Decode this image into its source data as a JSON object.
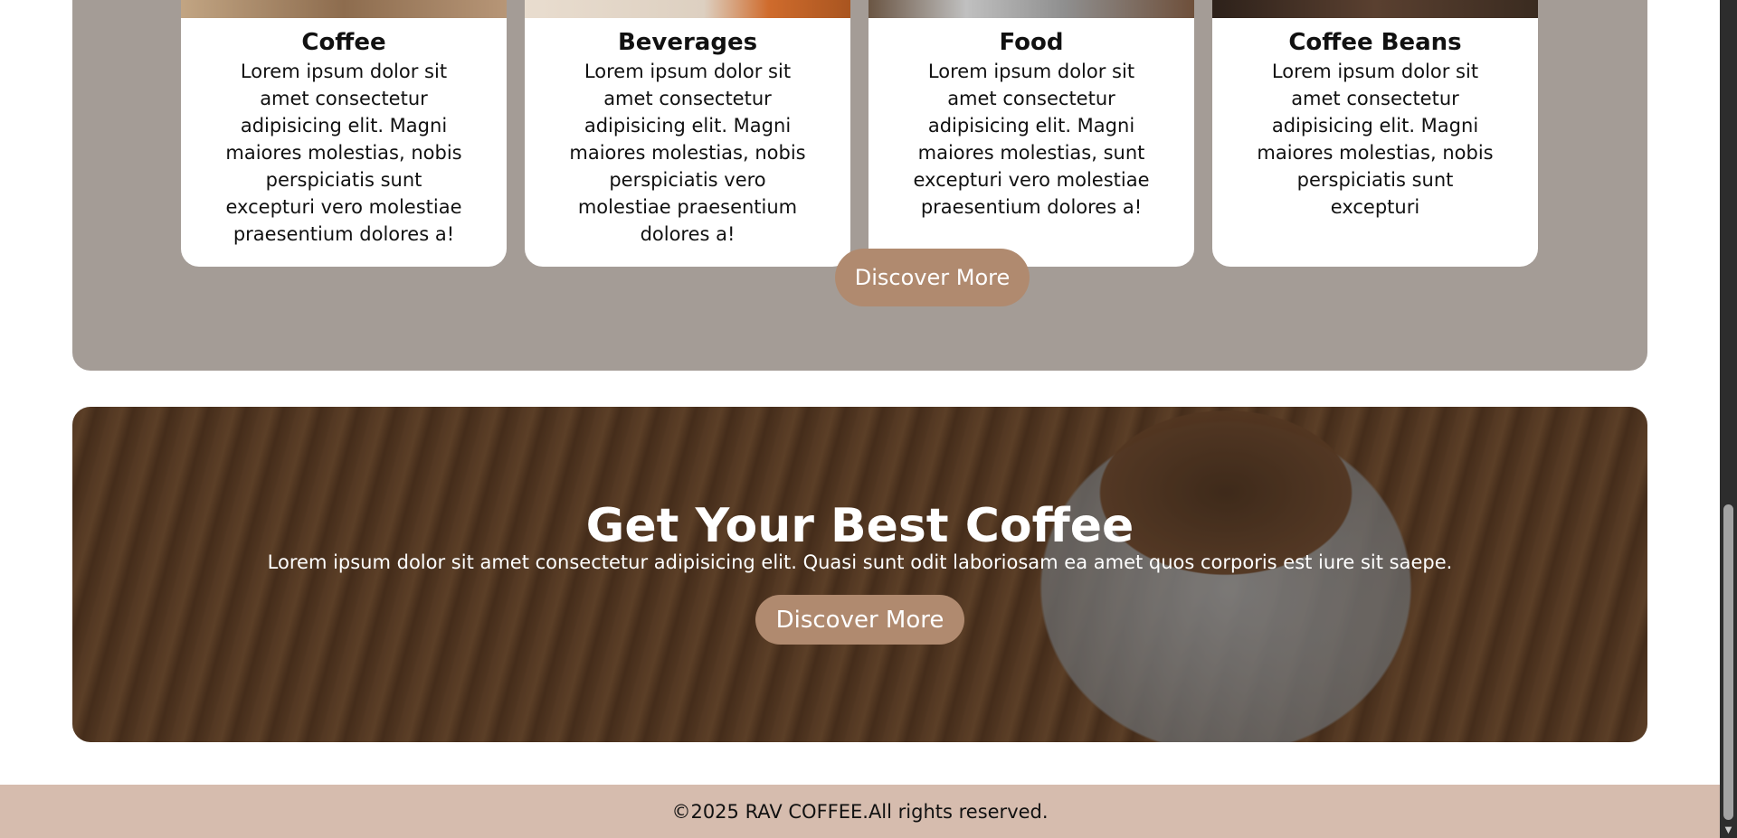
{
  "products": {
    "cards": [
      {
        "title": "Coffee",
        "description": "Lorem ipsum dolor sit amet consectetur adipisicing elit. Magni maiores molestias, nobis perspiciatis sunt excepturi vero molestiae praesentium dolores a!"
      },
      {
        "title": "Beverages",
        "description": "Lorem ipsum dolor sit amet consectetur adipisicing elit. Magni maiores molestias, nobis perspiciatis vero molestiae praesentium dolores a!"
      },
      {
        "title": "Food",
        "description": "Lorem ipsum dolor sit amet consectetur adipisicing elit. Magni maiores molestias, sunt excepturi vero molestiae praesentium dolores a!"
      },
      {
        "title": "Coffee Beans",
        "description": "Lorem ipsum dolor sit amet consectetur adipisicing elit. Magni maiores molestias, nobis perspiciatis sunt excepturi"
      }
    ],
    "button_label": "Discover More"
  },
  "hero": {
    "title": "Get Your Best Coffee",
    "subtitle": "Lorem ipsum dolor sit amet consectetur adipisicing elit. Quasi sunt odit laboriosam ea amet quos corporis est iure sit saepe.",
    "button_label": "Discover More"
  },
  "footer": {
    "copyright": "©2025 RAV COFFEE.All rights reserved."
  },
  "colors": {
    "section_bg": "#a49c96",
    "button_bg": "#b08a6f",
    "footer_bg": "#d6bcae"
  }
}
